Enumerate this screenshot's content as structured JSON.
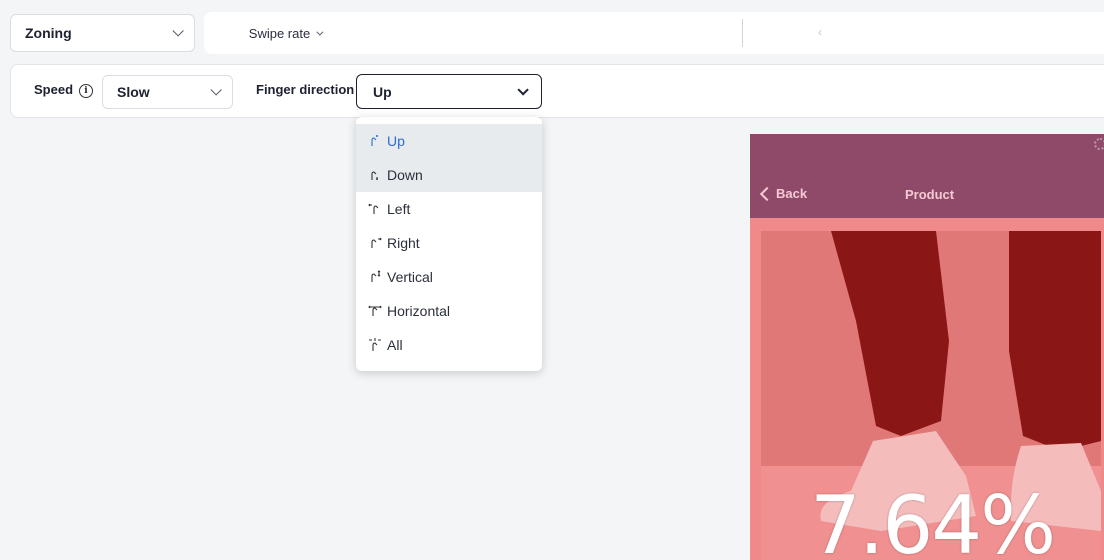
{
  "topbar": {
    "mode": "Zoning",
    "metric": "Swipe rate",
    "prev_arrow": "‹"
  },
  "filters": {
    "speed_label": "Speed",
    "speed_value": "Slow",
    "finger_label": "Finger direction",
    "finger_value": "Up"
  },
  "dropdown": {
    "items": [
      {
        "label": "Up",
        "icon": "swipe-up-icon",
        "state": "selected"
      },
      {
        "label": "Down",
        "icon": "swipe-down-icon",
        "state": "hover"
      },
      {
        "label": "Left",
        "icon": "swipe-left-icon"
      },
      {
        "label": "Right",
        "icon": "swipe-right-icon"
      },
      {
        "label": "Vertical",
        "icon": "swipe-vertical-icon"
      },
      {
        "label": "Horizontal",
        "icon": "swipe-horizontal-icon"
      },
      {
        "label": "All",
        "icon": "swipe-all-icon"
      }
    ]
  },
  "preview": {
    "back": "Back",
    "title": "Product",
    "rate": "7.64%",
    "header_color": "#8e4a68",
    "heat_color": "#f08a8a"
  },
  "colors": {
    "accent": "#2f6bd7",
    "background": "#f4f5f7"
  }
}
